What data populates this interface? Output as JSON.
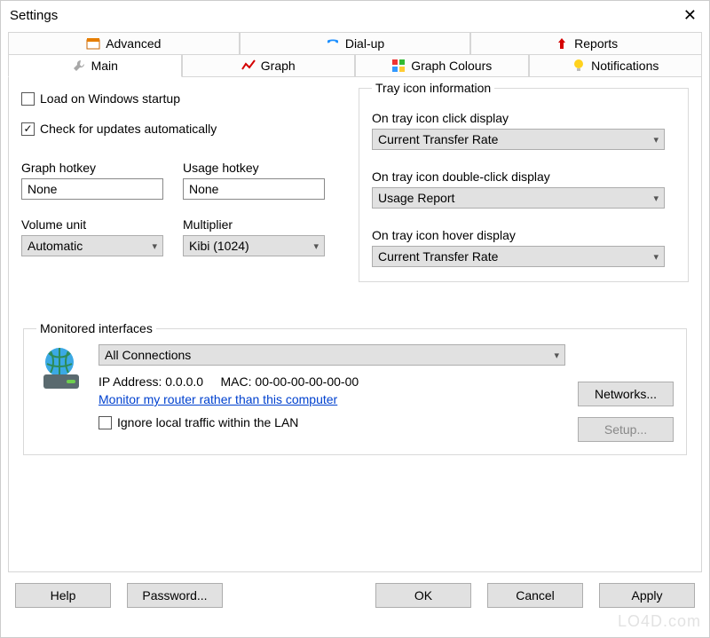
{
  "window": {
    "title": "Settings"
  },
  "tabs_top": {
    "advanced": "Advanced",
    "dialup": "Dial-up",
    "reports": "Reports"
  },
  "tabs_second": {
    "main": "Main",
    "graph": "Graph",
    "graph_colours": "Graph Colours",
    "notifications": "Notifications"
  },
  "main": {
    "load_startup_label": "Load on Windows startup",
    "check_updates_label": "Check for updates automatically",
    "graph_hotkey_label": "Graph hotkey",
    "graph_hotkey_value": "None",
    "usage_hotkey_label": "Usage hotkey",
    "usage_hotkey_value": "None",
    "volume_unit_label": "Volume unit",
    "volume_unit_value": "Automatic",
    "multiplier_label": "Multiplier",
    "multiplier_value": "Kibi (1024)"
  },
  "tray": {
    "legend": "Tray icon information",
    "click_label": "On tray icon click display",
    "click_value": "Current Transfer Rate",
    "dblclick_label": "On tray icon double-click display",
    "dblclick_value": "Usage Report",
    "hover_label": "On tray icon hover display",
    "hover_value": "Current Transfer Rate"
  },
  "monitored": {
    "legend": "Monitored interfaces",
    "connection_value": "All Connections",
    "ip_label": "IP Address:",
    "ip_value": "0.0.0.0",
    "mac_label": "MAC:",
    "mac_value": "00-00-00-00-00-00",
    "router_link": "Monitor my router rather than this computer",
    "ignore_lan_label": "Ignore local traffic within the LAN",
    "networks_btn": "Networks...",
    "setup_btn": "Setup..."
  },
  "buttons": {
    "help": "Help",
    "password": "Password...",
    "ok": "OK",
    "cancel": "Cancel",
    "apply": "Apply"
  },
  "watermark": "LO4D.com"
}
